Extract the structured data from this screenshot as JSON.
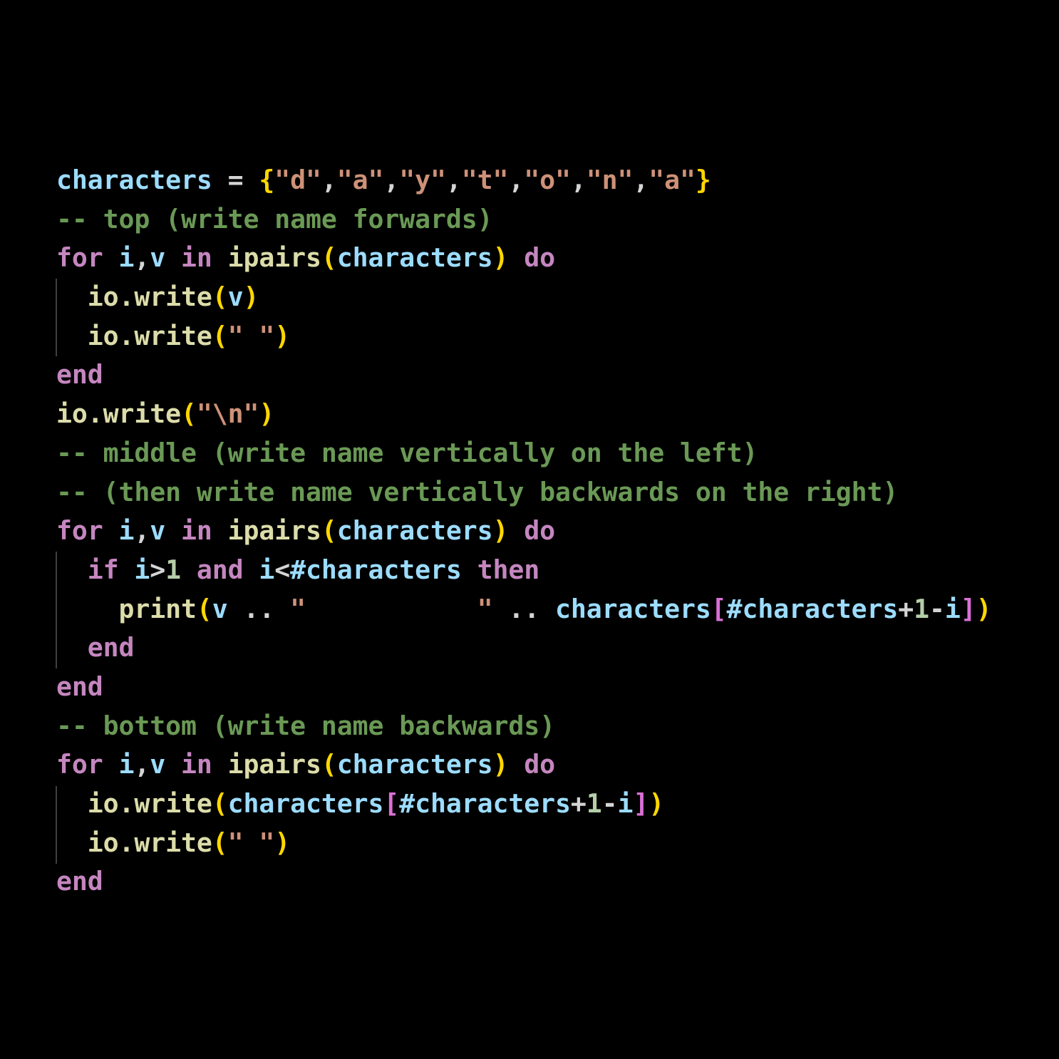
{
  "editor": {
    "language": "lua",
    "theme": "dark",
    "background": "#000000",
    "colors": {
      "variable": "#9cdcfe",
      "function": "#dcdcaa",
      "keyword": "#c586c0",
      "string": "#ce9178",
      "number": "#b5cea8",
      "comment": "#6a9955",
      "bracket_level_1": "#ffd700",
      "bracket_level_2": "#da70d6"
    },
    "lines": [
      "characters = {\"d\",\"a\",\"y\",\"t\",\"o\",\"n\",\"a\"}",
      "-- top (write name forwards)",
      "for i,v in ipairs(characters) do",
      "  io.write(v)",
      "  io.write(\" \")",
      "end",
      "io.write(\"\\n\")",
      "-- middle (write name vertically on the left)",
      "-- (then write name vertically backwards on the right)",
      "for i,v in ipairs(characters) do",
      "  if i>1 and i<#characters then",
      "    print(v .. \"           \" .. characters[#characters+1-i])",
      "  end",
      "end",
      "-- bottom (write name backwards)",
      "for i,v in ipairs(characters) do",
      "  io.write(characters[#characters+1-i])",
      "  io.write(\" \")",
      "end"
    ]
  }
}
